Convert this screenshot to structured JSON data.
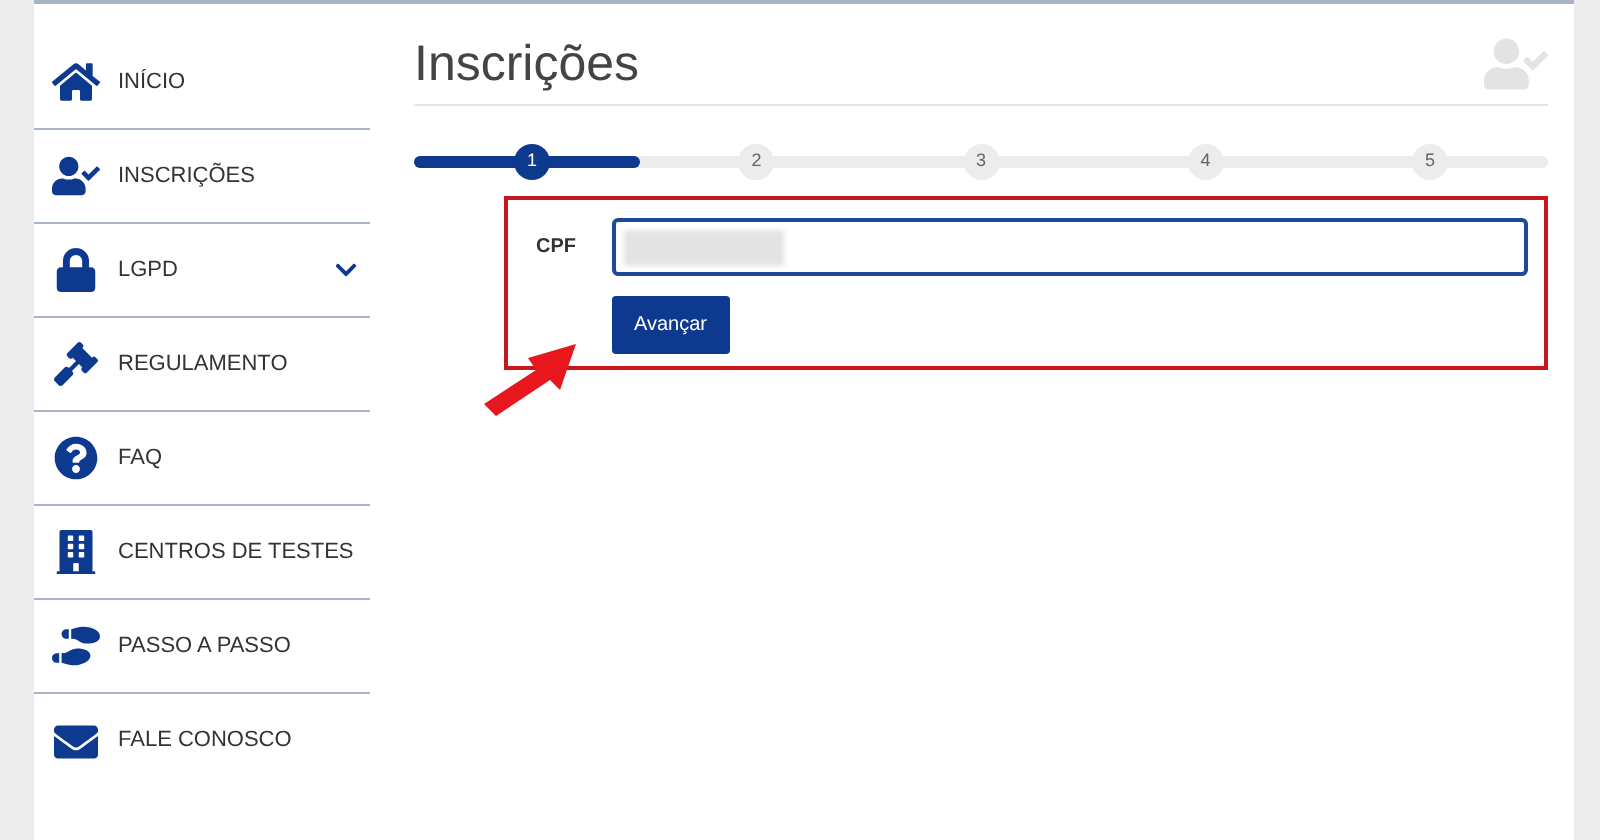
{
  "sidebar": {
    "items": [
      {
        "label": "INÍCIO",
        "kind": "link"
      },
      {
        "label": "INSCRIÇÕES",
        "kind": "link"
      },
      {
        "label": "LGPD",
        "kind": "group",
        "expanded": false
      },
      {
        "label": "REGULAMENTO",
        "kind": "link"
      },
      {
        "label": "FAQ",
        "kind": "link"
      },
      {
        "label": "CENTROS DE TESTES",
        "kind": "link"
      },
      {
        "label": "PASSO A PASSO",
        "kind": "link"
      },
      {
        "label": "FALE CONOSCO",
        "kind": "link"
      }
    ]
  },
  "page_title": "Inscrições",
  "stepper": {
    "level": 0.2,
    "steps": [
      {
        "label": "1",
        "selected": true
      },
      {
        "label": "2",
        "selected": false
      },
      {
        "label": "3",
        "selected": false
      },
      {
        "label": "4",
        "selected": false
      },
      {
        "label": "5",
        "selected": false
      }
    ]
  },
  "form": {
    "field_label": "CPF",
    "submit": "Avançar"
  }
}
